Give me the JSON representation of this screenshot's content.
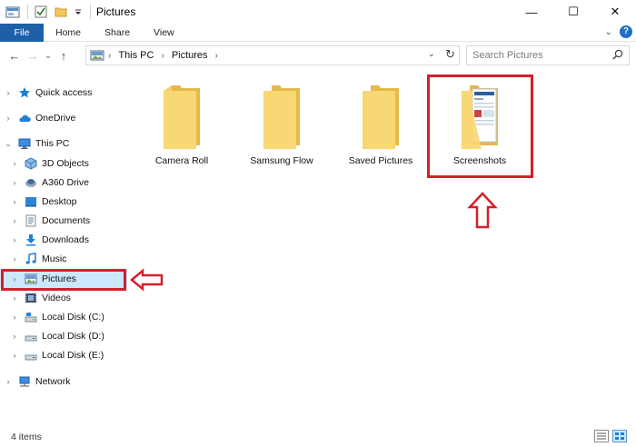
{
  "window": {
    "title": "Pictures",
    "controls": {
      "minimize": "—",
      "maximize": "☐",
      "close": "✕"
    }
  },
  "ribbon": {
    "tabs": [
      "File",
      "Home",
      "Share",
      "View"
    ],
    "help": "?"
  },
  "address": {
    "crumbs": [
      "This PC",
      "Pictures"
    ],
    "search_placeholder": "Search Pictures"
  },
  "sidebar": {
    "items": [
      {
        "label": "Quick access",
        "icon": "star-icon"
      },
      {
        "label": "OneDrive",
        "icon": "cloud-icon"
      },
      {
        "label": "This PC",
        "icon": "computer-icon"
      },
      {
        "label": "3D Objects",
        "icon": "cube-icon"
      },
      {
        "label": "A360 Drive",
        "icon": "a360-icon"
      },
      {
        "label": "Desktop",
        "icon": "desktop-icon"
      },
      {
        "label": "Documents",
        "icon": "document-icon"
      },
      {
        "label": "Downloads",
        "icon": "download-icon"
      },
      {
        "label": "Music",
        "icon": "music-icon"
      },
      {
        "label": "Pictures",
        "icon": "pictures-icon"
      },
      {
        "label": "Videos",
        "icon": "video-icon"
      },
      {
        "label": "Local Disk (C:)",
        "icon": "drive-c-icon"
      },
      {
        "label": "Local Disk (D:)",
        "icon": "drive-icon"
      },
      {
        "label": "Local Disk (E:)",
        "icon": "drive-icon"
      },
      {
        "label": "Network",
        "icon": "network-icon"
      }
    ]
  },
  "folders": [
    {
      "name": "Camera Roll"
    },
    {
      "name": "Samsung Flow"
    },
    {
      "name": "Saved Pictures"
    },
    {
      "name": "Screenshots"
    }
  ],
  "status": {
    "items": "4 items"
  },
  "colors": {
    "file_tab": "#1f5fa8",
    "selection": "#cce8ff",
    "annotation_red": "#d3202a",
    "folder_yellow": "#f8d775"
  }
}
